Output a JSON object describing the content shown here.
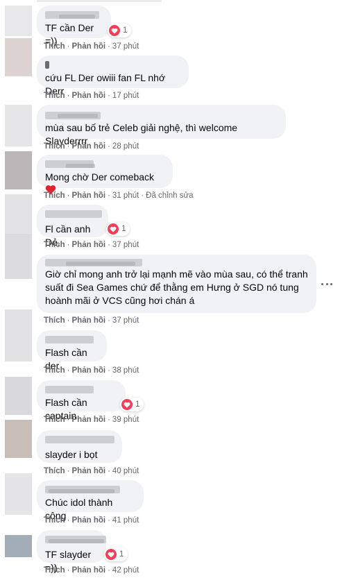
{
  "actions": {
    "like": "Thích",
    "reply": "Phản hồi",
    "edited": "Đã chỉnh sửa"
  },
  "colors": {
    "heart": "#f33e58",
    "bubble": "#f0f2f5",
    "meta": "#65676b"
  },
  "comments": [
    {
      "text": "TF cần Der =))",
      "time": "37 phút",
      "reactions": "1",
      "reaction_icon": "heart-icon",
      "avatar_color": "#e7e7e9"
    },
    {
      "text": "cứu FL Der owiii fan FL nhớ Derr",
      "time": "17 phút",
      "avatar_color": "#ddd3d0"
    },
    {
      "text": "mùa sau bố trẻ Celeb giải nghệ, thì welcome Slayderrrr",
      "time": "28 phút",
      "avatar_color": "#e6e6e8"
    },
    {
      "text": "Mong chờ Der comeback",
      "emoji": "heart-emoji",
      "time": "31 phút",
      "edited": true,
      "avatar_color": "#bdb6b8"
    },
    {
      "text": "Fl cần anh Dẻ.",
      "time": "37 phút",
      "reactions": "1",
      "reaction_icon": "heart-icon",
      "avatar_color": "#e3e3e5"
    },
    {
      "text": "Giờ chỉ mong anh trở lại mạnh mẽ vào mùa sau, có thể tranh suất đi Sea Games chứ để thằng em Hưng ở SGD nó tung hoành mãi ở VCS cũng hơi chán á",
      "time": "37 phút",
      "more_options": true,
      "avatar_color": "#dcdcdf"
    },
    {
      "text": "Flash cần der",
      "time": "38 phút",
      "avatar_color": "#e2e2e4"
    },
    {
      "text": "Flash cần captain",
      "time": "39 phút",
      "reactions": "1",
      "reaction_icon": "heart-icon",
      "avatar_color": "#d9d9dc"
    },
    {
      "text": "slayder i bọt",
      "time": "40 phút",
      "avatar_color": "#c9bdb7"
    },
    {
      "text": "Chúc idol thành công",
      "time": "41 phút",
      "avatar_color": "#e5e5e7"
    },
    {
      "text": "TF slayder =))",
      "time": "42 phút",
      "reactions": "1",
      "reaction_icon": "heart-icon",
      "avatar_color": "#a3adb8"
    }
  ]
}
